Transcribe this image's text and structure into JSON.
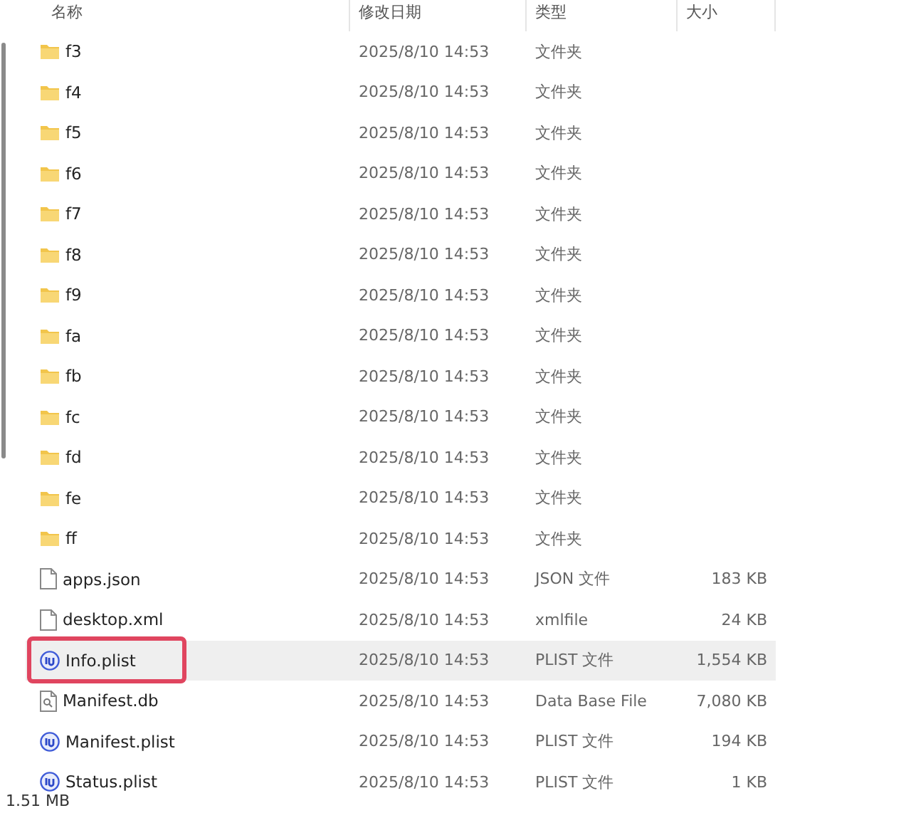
{
  "columns": [
    "名称",
    "修改日期",
    "类型",
    "大小"
  ],
  "rows": [
    {
      "kind": "folder",
      "name": "f3",
      "modified": "2025/8/10 14:53",
      "type": "文件夹",
      "selected": false,
      "marked": false
    },
    {
      "kind": "folder",
      "name": "f4",
      "modified": "2025/8/10 14:53",
      "type": "文件夹",
      "selected": false,
      "marked": false
    },
    {
      "kind": "folder",
      "name": "f5",
      "modified": "2025/8/10 14:53",
      "type": "文件夹",
      "selected": false,
      "marked": false
    },
    {
      "kind": "folder",
      "name": "f6",
      "modified": "2025/8/10 14:53",
      "type": "文件夹",
      "selected": false,
      "marked": false
    },
    {
      "kind": "folder",
      "name": "f7",
      "modified": "2025/8/10 14:53",
      "type": "文件夹",
      "selected": false,
      "marked": false
    },
    {
      "kind": "folder",
      "name": "f8",
      "modified": "2025/8/10 14:53",
      "type": "文件夹",
      "selected": false,
      "marked": false
    },
    {
      "kind": "folder",
      "name": "f9",
      "modified": "2025/8/10 14:53",
      "type": "文件夹",
      "selected": false,
      "marked": false
    },
    {
      "kind": "folder",
      "name": "fa",
      "modified": "2025/8/10 14:53",
      "type": "文件夹",
      "selected": false,
      "marked": false
    },
    {
      "kind": "folder",
      "name": "fb",
      "modified": "2025/8/10 14:53",
      "type": "文件夹",
      "selected": false,
      "marked": false
    },
    {
      "kind": "folder",
      "name": "fc",
      "modified": "2025/8/10 14:53",
      "type": "文件夹",
      "selected": false,
      "marked": false
    },
    {
      "kind": "folder",
      "name": "fd",
      "modified": "2025/8/10 14:53",
      "type": "文件夹",
      "selected": false,
      "marked": false
    },
    {
      "kind": "folder",
      "name": "fe",
      "modified": "2025/8/10 14:53",
      "type": "文件夹",
      "selected": false,
      "marked": false
    },
    {
      "kind": "folder",
      "name": "ff",
      "modified": "2025/8/10 14:53",
      "type": "文件夹",
      "selected": false,
      "marked": false
    },
    {
      "kind": "file",
      "name": "apps.json",
      "modified": "2025/8/10 14:53",
      "type": "JSON 文件",
      "size": "183 KB",
      "selected": false,
      "marked": false
    },
    {
      "kind": "file",
      "name": "desktop.xml",
      "modified": "2025/8/10 14:53",
      "type": "xmlfile",
      "size": "24 KB",
      "selected": false,
      "marked": false
    },
    {
      "kind": "plist",
      "name": "Info.plist",
      "modified": "2025/8/10 14:53",
      "type": "PLIST 文件",
      "size": "1,554 KB",
      "selected": true,
      "marked": true
    },
    {
      "kind": "db",
      "name": "Manifest.db",
      "modified": "2025/8/10 14:53",
      "type": "Data Base File",
      "size": "7,080 KB",
      "selected": false,
      "marked": false
    },
    {
      "kind": "plist",
      "name": "Manifest.plist",
      "modified": "2025/8/10 14:53",
      "type": "PLIST 文件",
      "size": "194 KB",
      "selected": false,
      "marked": false
    },
    {
      "kind": "plist",
      "name": "Status.plist",
      "modified": "2025/8/10 14:53",
      "type": "PLIST 文件",
      "size": "1 KB",
      "selected": false,
      "marked": false
    }
  ],
  "status_bar": {
    "size": "1.51 MB"
  }
}
